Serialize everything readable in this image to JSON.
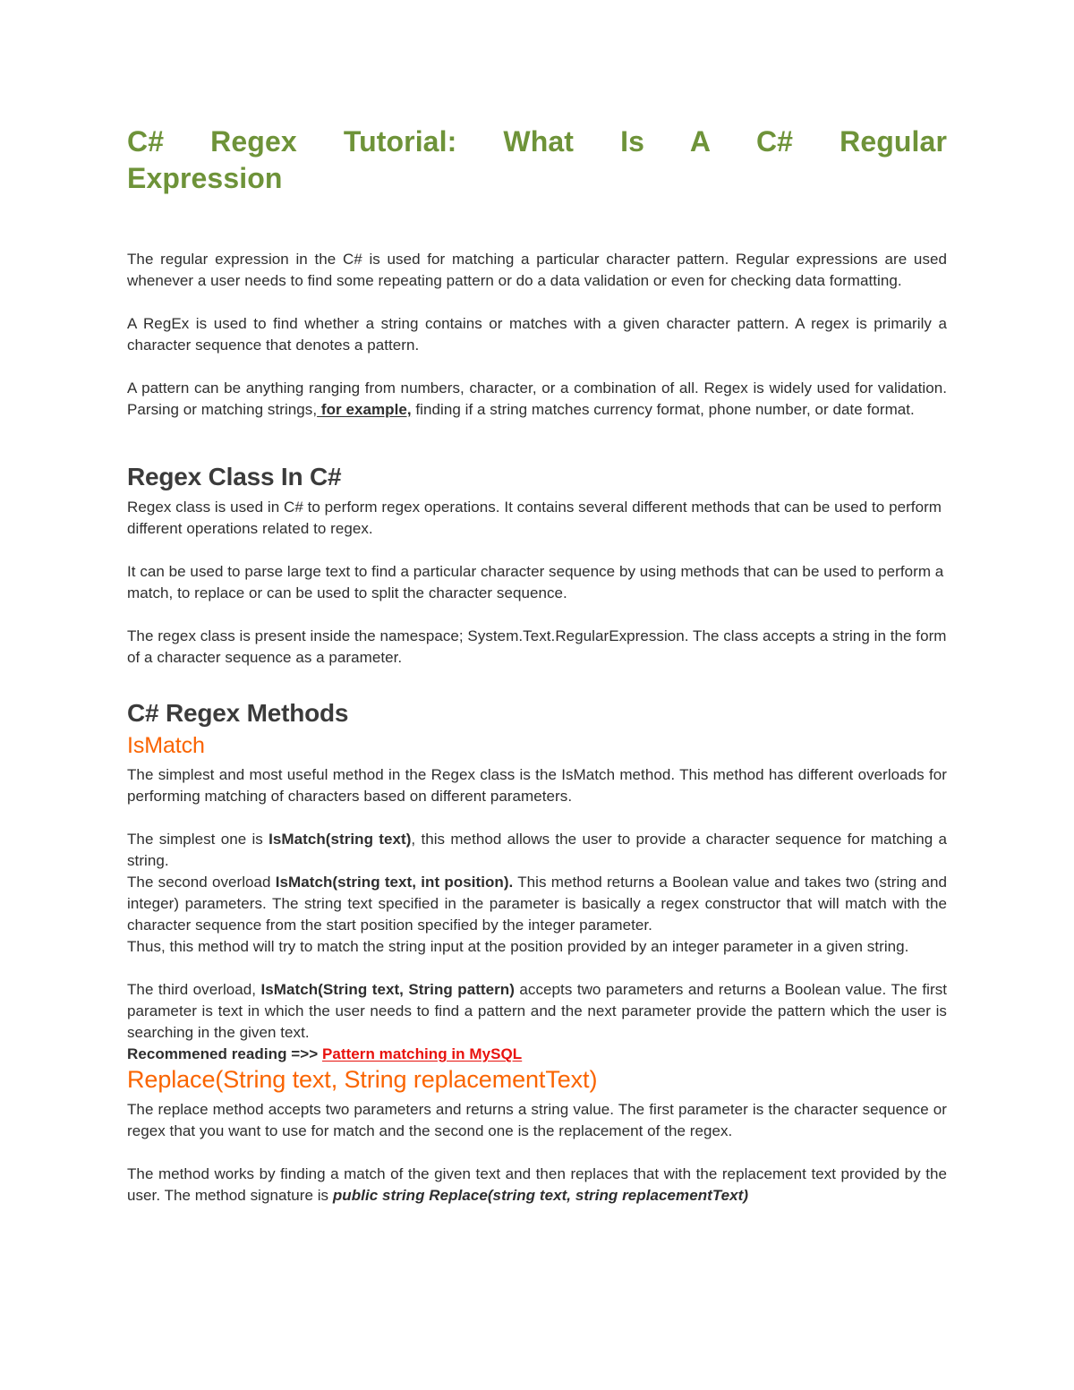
{
  "document": {
    "title_line1": "C#  Regex  Tutorial:  What  Is  A  C#  Regular",
    "title_line2": "Expression",
    "colors": {
      "title_green": "#6E9339",
      "heading_gray": "#3B3B3B",
      "accent_orange": "#FA6400",
      "link_red": "#E8120E",
      "body_text": "#2E2E2E",
      "background": "#FFFFFF"
    },
    "intro": {
      "p1": "The regular expression in the C# is used for matching a particular character pattern. Regular expressions are used whenever a user needs to find some repeating pattern or do a data validation or even for checking data formatting.",
      "p2": "A RegEx is used to find whether a string contains or matches with a given character pattern. A regex is primarily a character sequence that denotes a pattern.",
      "p3_part1": "A pattern can be anything ranging from numbers, character, or a combination of all. Regex is widely used for validation. Parsing or matching strings,",
      "p3_emphasis": " for example,",
      "p3_part2": " finding if a string matches currency format, phone number, or date format."
    },
    "section_regex_class": {
      "heading": "Regex Class In C#",
      "p1": "Regex class is used in C# to perform regex operations. It contains several different methods that can be used to perform different operations related to regex.",
      "p2": "It can be used to parse large text to find a particular character sequence by using methods that can be used to perform a match, to replace or can be used to split the character sequence.",
      "p3": "The regex class is present inside the namespace; System.Text.RegularExpression. The class accepts a string in the form of a character sequence as a parameter."
    },
    "section_regex_methods": {
      "heading": "C# Regex Methods",
      "ismatch": {
        "heading": "IsMatch",
        "p1": "The simplest and most useful method in the Regex class is the IsMatch method. This method has different overloads for performing matching of characters based on different parameters.",
        "overload1_pre": "The simplest one is ",
        "overload1_bold": "IsMatch(string text)",
        "overload1_post": ", this method allows the user to provide a character sequence for matching a string.",
        "overload2_pre": "The second overload ",
        "overload2_bold": "IsMatch(string text, int position).",
        "overload2_post": " This method returns a Boolean value and takes two (string and integer) parameters. The string text specified in the parameter is basically a regex constructor that will match with the character sequence from the start position specified by the integer parameter.",
        "overload2_extra": "Thus, this method will try to match the string input at the position provided by an integer parameter in a given string.",
        "overload3_pre": "The third overload, ",
        "overload3_bold": "IsMatch(String text, String pattern)",
        "overload3_post": " accepts two parameters and returns a Boolean value. The first parameter is text in which the user needs to find a pattern and the next parameter provide the pattern which the user is searching in the given text."
      },
      "recommended_reading": {
        "label": "Recommened reading =>> ",
        "link_text": "Pattern matching in MySQL"
      },
      "replace": {
        "heading": "Replace(String text, String replacementText)",
        "p1": "The replace method accepts two parameters and returns a string value. The first parameter is the character sequence or regex that you want to use for match and the second one is the replacement of the regex.",
        "p2_pre": "The method works by finding a match of the given text and then replaces that with the replacement text provided by the user. The method signature is ",
        "p2_signature": "public string Replace(string text, string replacementText)"
      }
    }
  }
}
